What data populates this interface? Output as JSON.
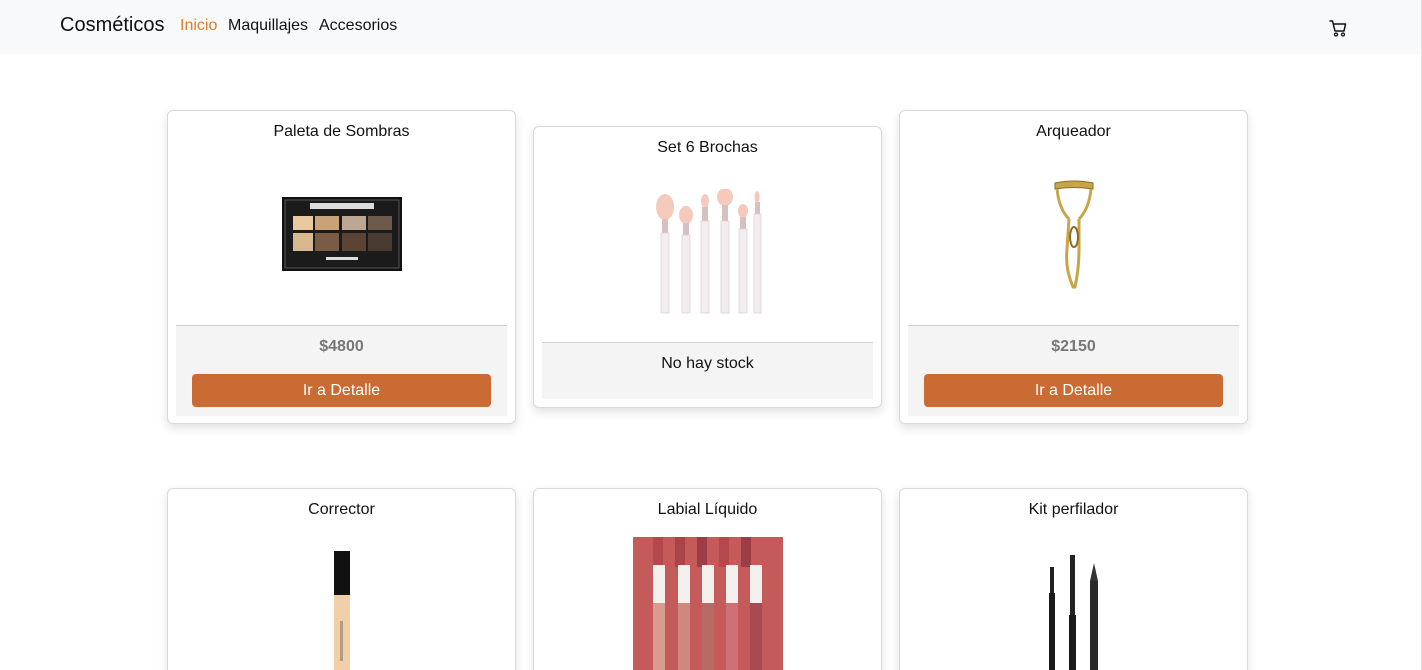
{
  "navbar": {
    "brand": "Cosméticos",
    "links": [
      "Inicio",
      "Maquillajes",
      "Accesorios"
    ],
    "active_link": "Inicio",
    "cart_icon": "cart-icon"
  },
  "colors": {
    "accent": "#c96b33",
    "active_link": "#e07a2a",
    "price_text": "#777777"
  },
  "products": [
    {
      "title": "Paleta de Sombras",
      "price": "$4800",
      "button": "Ir a Detalle",
      "image": "eyeshadow-palette"
    },
    {
      "title": "Set 6 Brochas",
      "status": "No hay stock",
      "image": "brush-set"
    },
    {
      "title": "Arqueador",
      "price": "$2150",
      "button": "Ir a Detalle",
      "image": "eyelash-curler"
    },
    {
      "title": "Corrector",
      "image": "concealer"
    },
    {
      "title": "Labial Líquido",
      "image": "liquid-lipsticks"
    },
    {
      "title": "Kit perfilador",
      "image": "brow-kit"
    }
  ]
}
